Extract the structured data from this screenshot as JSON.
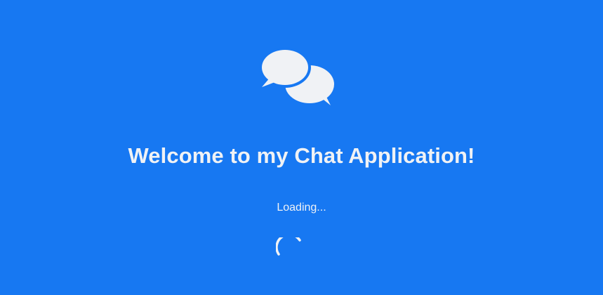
{
  "splash": {
    "logo_icon": "chat-bubbles-icon",
    "title": "Welcome to my Chat Application!",
    "status": "Loading...",
    "spinner_icon": "loading-spinner-icon"
  },
  "colors": {
    "background": "#1778F2",
    "foreground": "#F0F2F5"
  }
}
